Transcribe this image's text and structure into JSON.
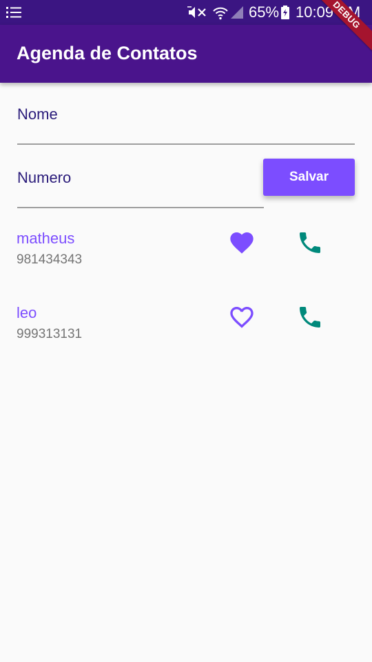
{
  "status_bar": {
    "battery_percent": "65%",
    "time": "10:09 PM",
    "icons": [
      "menu-icon",
      "mute-icon",
      "wifi-icon",
      "signal-icon",
      "battery-charging-icon"
    ]
  },
  "debug_banner": "DEBUG",
  "app_bar": {
    "title": "Agenda de Contatos"
  },
  "form": {
    "name_label": "Nome",
    "number_label": "Numero",
    "save_label": "Salvar"
  },
  "contacts": [
    {
      "name": "matheus",
      "phone": "981434343",
      "favorite": true
    },
    {
      "name": "leo",
      "phone": "999313131",
      "favorite": false
    }
  ],
  "colors": {
    "status_bar": "#3b1582",
    "app_bar": "#4a148c",
    "accent": "#7c4dff",
    "call": "#00897b",
    "debug": "#a5142e"
  }
}
